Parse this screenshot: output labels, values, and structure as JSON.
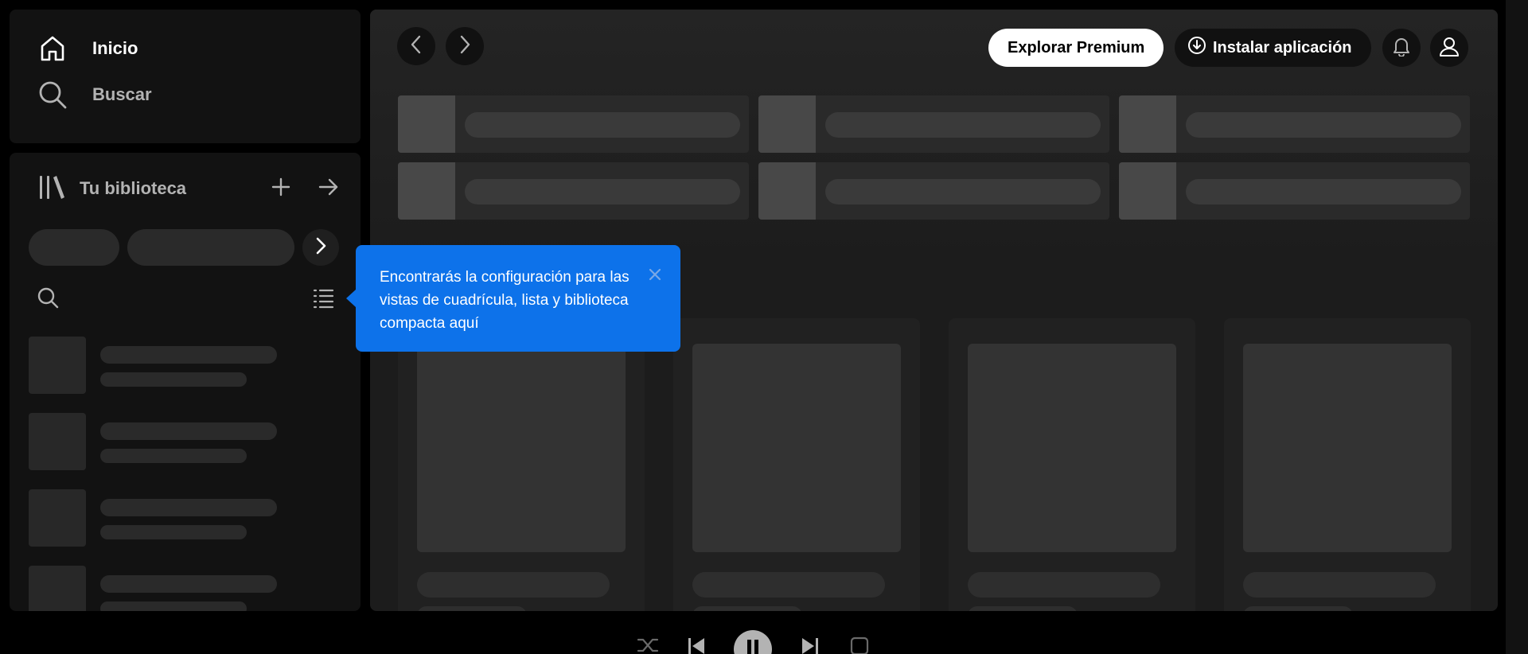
{
  "nav": {
    "home_label": "Inicio",
    "search_label": "Buscar"
  },
  "library": {
    "title": "Tu biblioteca"
  },
  "header": {
    "premium_label": "Explorar Premium",
    "install_label": "Instalar aplicación"
  },
  "tooltip": {
    "text": "Encontrarás la configuración para las vistas de cuadrícula, lista y biblioteca compacta aquí"
  },
  "icons": {
    "home": "home-icon",
    "search": "search-icon",
    "library": "library-icon",
    "plus": "plus-icon",
    "arrow_right": "arrow-right-icon",
    "bell": "bell-icon",
    "user": "user-icon",
    "download": "download-icon"
  },
  "colors": {
    "background": "#000000",
    "panel": "#121212",
    "accent_tooltip": "#0d72ea",
    "skeleton": "#2a2a2a"
  }
}
